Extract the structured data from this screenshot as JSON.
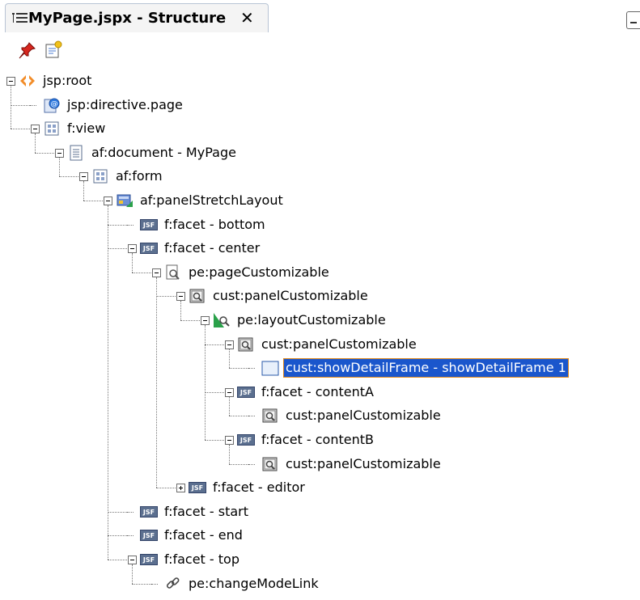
{
  "tab": {
    "title": "MyPage.jspx - Structure",
    "close_label": "✕"
  },
  "toolbar": {
    "pin_icon": "pushpin-icon",
    "edit_icon": "edit-icon"
  },
  "tree": [
    {
      "label": "jsp:root",
      "level": 0,
      "icon": "xml-tag-icon",
      "expander": "minus"
    },
    {
      "label": "jsp:directive.page",
      "level": 1,
      "icon": "directive-icon",
      "expander": "none"
    },
    {
      "label": "f:view",
      "level": 1,
      "icon": "grid-icon",
      "expander": "minus"
    },
    {
      "label": "af:document - MyPage",
      "level": 2,
      "icon": "document-icon",
      "expander": "minus"
    },
    {
      "label": "af:form",
      "level": 3,
      "icon": "grid-icon",
      "expander": "minus"
    },
    {
      "label": "af:panelStretchLayout",
      "level": 4,
      "icon": "layout-icon",
      "expander": "minus"
    },
    {
      "label": "f:facet - bottom",
      "level": 5,
      "icon": "jsf-icon",
      "expander": "none"
    },
    {
      "label": "f:facet - center",
      "level": 5,
      "icon": "jsf-icon",
      "expander": "minus"
    },
    {
      "label": "pe:pageCustomizable",
      "level": 6,
      "icon": "page-customizable-icon",
      "expander": "minus"
    },
    {
      "label": "cust:panelCustomizable",
      "level": 7,
      "icon": "panel-customizable-icon",
      "expander": "minus"
    },
    {
      "label": "pe:layoutCustomizable",
      "level": 8,
      "icon": "layout-customizable-icon",
      "expander": "minus"
    },
    {
      "label": "cust:panelCustomizable",
      "level": 9,
      "icon": "panel-customizable-icon",
      "expander": "minus"
    },
    {
      "label": "cust:showDetailFrame - showDetailFrame 1",
      "level": 10,
      "icon": "frame-icon",
      "expander": "none",
      "selected": true
    },
    {
      "label": "f:facet - contentA",
      "level": 9,
      "icon": "jsf-icon",
      "expander": "minus"
    },
    {
      "label": "cust:panelCustomizable",
      "level": 10,
      "icon": "panel-customizable-icon",
      "expander": "none"
    },
    {
      "label": "f:facet - contentB",
      "level": 9,
      "icon": "jsf-icon",
      "expander": "minus"
    },
    {
      "label": "cust:panelCustomizable",
      "level": 10,
      "icon": "panel-customizable-icon",
      "expander": "none"
    },
    {
      "label": "f:facet - editor",
      "level": 7,
      "icon": "jsf-icon",
      "expander": "plus"
    },
    {
      "label": "f:facet - start",
      "level": 5,
      "icon": "jsf-icon",
      "expander": "none"
    },
    {
      "label": "f:facet - end",
      "level": 5,
      "icon": "jsf-icon",
      "expander": "none"
    },
    {
      "label": "f:facet - top",
      "level": 5,
      "icon": "jsf-icon",
      "expander": "minus"
    },
    {
      "label": "pe:changeModeLink",
      "level": 6,
      "icon": "link-icon",
      "expander": "none"
    }
  ],
  "colors": {
    "selection": "#1a56cc",
    "selection_outline": "#e08a1e",
    "jsf_badge": "#5b6f8f"
  }
}
